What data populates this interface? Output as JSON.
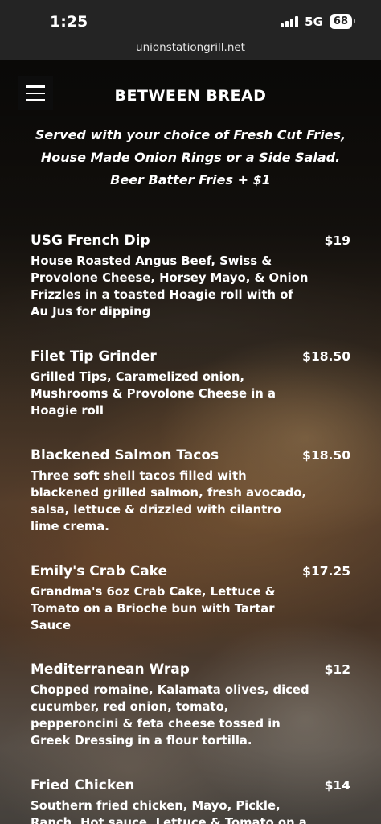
{
  "status": {
    "time": "1:25",
    "network": "5G",
    "battery": "68"
  },
  "browser": {
    "url": "unionstationgrill.net"
  },
  "page": {
    "title": "BETWEEN BREAD",
    "intro_line1": "Served with your choice of Fresh Cut Fries,",
    "intro_line2": "House Made Onion Rings or a Side Salad.",
    "intro_line3": "Beer Batter Fries + $1"
  },
  "menu": [
    {
      "name": "USG French Dip",
      "price": "$19",
      "desc": "House Roasted Angus Beef, Swiss & Provolone Cheese, Horsey Mayo, & Onion Frizzles in a toasted Hoagie roll with of Au Jus for dipping"
    },
    {
      "name": "Filet Tip Grinder",
      "price": "$18.50",
      "desc": "Grilled Tips, Caramelized onion, Mushrooms & Provolone Cheese in a Hoagie roll"
    },
    {
      "name": "Blackened Salmon Tacos",
      "price": "$18.50",
      "desc": "Three soft shell tacos filled with blackened grilled salmon, fresh avocado, salsa, lettuce & drizzled with cilantro lime crema."
    },
    {
      "name": "Emily's Crab Cake",
      "price": "$17.25",
      "desc": "Grandma's 6oz Crab Cake, Lettuce & Tomato on a Brioche bun with Tartar Sauce"
    },
    {
      "name": "Mediterranean Wrap",
      "price": "$12",
      "desc": "Chopped romaine, Kalamata olives, diced cucumber, red onion, tomato, pepperoncini & feta cheese tossed in Greek Dressing in a flour tortilla."
    },
    {
      "name": "Fried Chicken",
      "price": "$14",
      "desc": "Southern fried chicken, Mayo, Pickle, Ranch, Hot sauce, Lettuce & Tomato on a"
    }
  ]
}
